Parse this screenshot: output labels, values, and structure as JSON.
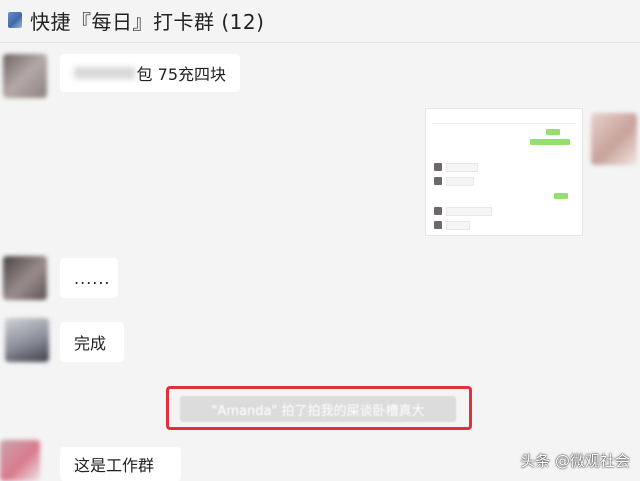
{
  "window": {
    "title": "快捷『每日』打卡群 (12)"
  },
  "messages": [
    {
      "sender": "left",
      "text": "包 75充四块"
    },
    {
      "sender": "right",
      "type": "image"
    },
    {
      "sender": "left",
      "text": "......"
    },
    {
      "sender": "left",
      "text": "完成"
    },
    {
      "sender": "system",
      "text": "\"Amanda\" 拍了拍我的屎谈卧槽真大"
    },
    {
      "sender": "left",
      "text": "这是工作群"
    }
  ],
  "watermark": "头条 @微观社会",
  "colors": {
    "highlight": "#e0303a",
    "bubble": "#ffffff",
    "background": "#f4f4f4"
  }
}
